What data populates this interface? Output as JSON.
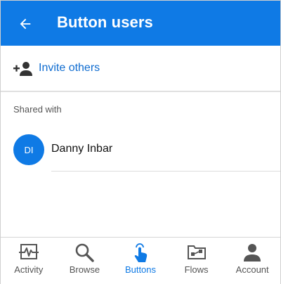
{
  "appbar": {
    "title": "Button users"
  },
  "invite": {
    "label": "Invite others"
  },
  "shared": {
    "section_label": "Shared with",
    "users": [
      {
        "initials": "DI",
        "name": "Danny Inbar"
      }
    ]
  },
  "nav": {
    "items": [
      {
        "label": "Activity",
        "icon": "activity-icon",
        "active": false
      },
      {
        "label": "Browse",
        "icon": "search-icon",
        "active": false
      },
      {
        "label": "Buttons",
        "icon": "touch-icon",
        "active": true
      },
      {
        "label": "Flows",
        "icon": "flows-icon",
        "active": false
      },
      {
        "label": "Account",
        "icon": "person-icon",
        "active": false
      }
    ]
  },
  "colors": {
    "primary": "#0f7ae5",
    "link": "#0f6cd0",
    "muted": "#555555"
  }
}
